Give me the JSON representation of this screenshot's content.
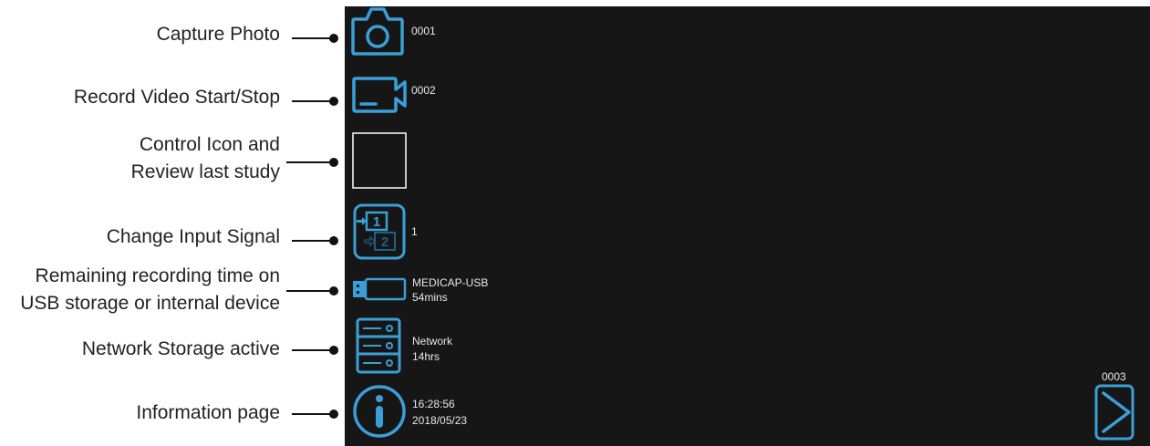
{
  "legend": {
    "capture_photo": "Capture Photo",
    "record_video": "Record Video Start/Stop",
    "control_icon_line1": "Control Icon and",
    "control_icon_line2": "Review last study",
    "change_input": "Change Input Signal",
    "remaining_line1": "Remaining recording time on",
    "remaining_line2": "USB storage or internal device",
    "network_storage": "Network Storage active",
    "information_page": "Information page"
  },
  "screen": {
    "photo_count": "0001",
    "video_count": "0002",
    "input_number": "1",
    "usb_name": "MEDICAP-USB",
    "usb_remaining": "54mins",
    "network_name": "Network",
    "network_remaining": "14hrs",
    "time": "16:28:56",
    "date": "2018/05/23",
    "next_count": "0003"
  },
  "icons": {
    "camera": "camera-icon",
    "video": "video-camera-icon",
    "control": "control-square-icon",
    "input": "input-signal-icon",
    "usb": "usb-drive-icon",
    "network": "network-storage-icon",
    "info": "info-icon",
    "next": "next-arrow-icon"
  },
  "colors": {
    "accent": "#3a9fd6",
    "screen_bg": "#161616"
  }
}
